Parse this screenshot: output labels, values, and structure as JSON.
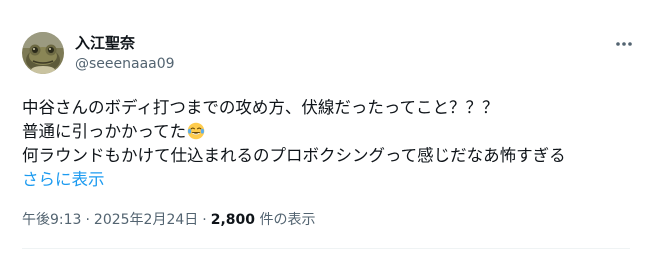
{
  "author": {
    "display_name": "入江聖奈",
    "handle": "@seeenaaa09"
  },
  "post": {
    "lines": [
      "中谷さんのボディ打つまでの攻め方、伏線だったってこと？？？",
      "普通に引っかかってた",
      "何ラウンドもかけて仕込まれるのプロボクシングって感じだなあ怖すぎる"
    ],
    "emoji": "face-with-tears-of-joy",
    "show_more": "さらに表示"
  },
  "meta": {
    "time": "午後9:13",
    "separator": "·",
    "date": "2025年2月24日",
    "views_count": "2,800",
    "views_label": "件の表示"
  },
  "icons": [
    "avatar-frog",
    "more-options-icon"
  ],
  "colors": {
    "link": "#1d9bf0",
    "secondary_text": "#536471",
    "primary_text": "#0f1419"
  }
}
